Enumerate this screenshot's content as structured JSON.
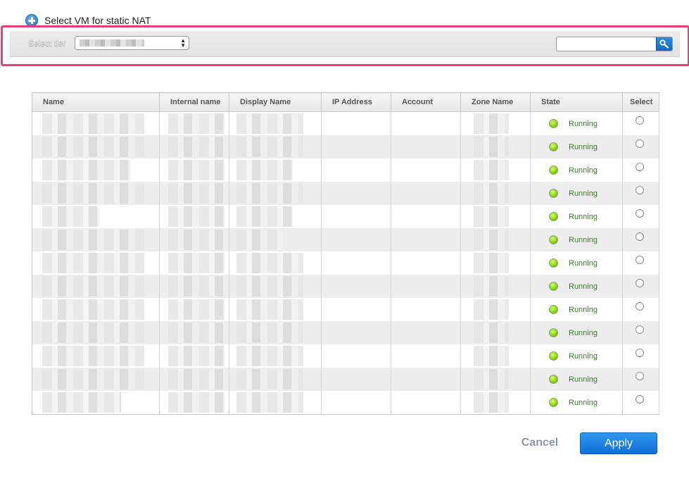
{
  "dialog": {
    "title": "Select VM for static NAT"
  },
  "toolbar": {
    "select_tier_label": "Select tier",
    "tier_value": "",
    "search_placeholder": ""
  },
  "table": {
    "columns": [
      "Name",
      "Internal name",
      "Display Name",
      "IP Address",
      "Account",
      "Zone Name",
      "State",
      "Select"
    ],
    "rows": [
      {
        "state": "Running"
      },
      {
        "state": "Running"
      },
      {
        "state": "Running"
      },
      {
        "state": "Running"
      },
      {
        "state": "Running"
      },
      {
        "state": "Running"
      },
      {
        "state": "Running"
      },
      {
        "state": "Running"
      },
      {
        "state": "Running"
      },
      {
        "state": "Running"
      },
      {
        "state": "Running"
      },
      {
        "state": "Running"
      },
      {
        "state": "Running"
      }
    ]
  },
  "actions": {
    "cancel_label": "Cancel",
    "apply_label": "Apply"
  },
  "colors": {
    "highlight": "#ee3b7a",
    "running": "#2f8a1f",
    "apply": "#1a7fe0"
  },
  "icons": {
    "title": "plus-circle-icon",
    "search": "search-icon",
    "state": "status-dot-icon"
  }
}
